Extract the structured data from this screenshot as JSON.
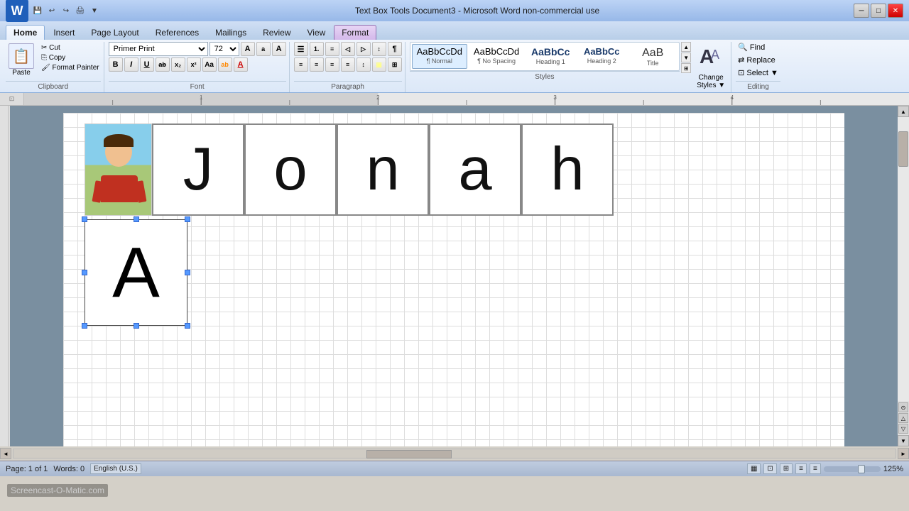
{
  "titlebar": {
    "title": "Text Box Tools    Document3 - Microsoft Word non-commercial use",
    "minimize": "─",
    "maximize": "□",
    "close": "✕"
  },
  "tabs": {
    "items": [
      "Home",
      "Insert",
      "Page Layout",
      "References",
      "Mailings",
      "Review",
      "View",
      "Format"
    ],
    "active": "Home",
    "format_tab": "Format"
  },
  "ribbon": {
    "clipboard": {
      "label": "Clipboard",
      "paste": "Paste",
      "cut": "✂ Cut",
      "copy": "⎘ Copy",
      "format_painter": "🖌 Format Painter"
    },
    "font": {
      "label": "Font",
      "font_name": "Primer Print",
      "font_size": "72",
      "grow": "A",
      "shrink": "a",
      "clear": "A",
      "bold": "B",
      "italic": "I",
      "underline": "U",
      "strikethrough": "ab",
      "subscript": "x₂",
      "superscript": "x²",
      "change_case": "Aa",
      "highlight": "ab",
      "font_color": "A"
    },
    "paragraph": {
      "label": "Paragraph",
      "bullets": "☰",
      "numbering": "1.",
      "outdent": "◁",
      "indent": "▷",
      "sort": "↕",
      "show_hide": "¶"
    },
    "styles": {
      "label": "Styles",
      "items": [
        {
          "id": "normal",
          "preview": "AaBbCcDd",
          "label": "¶ Normal",
          "active": true
        },
        {
          "id": "no-spacing",
          "preview": "AaBbCcDd",
          "label": "¶ No Spacing",
          "active": false
        },
        {
          "id": "heading1",
          "preview": "AaBbCc",
          "label": "Heading 1",
          "active": false
        },
        {
          "id": "heading2",
          "preview": "AaBbCc",
          "label": "Heading 2",
          "active": false
        },
        {
          "id": "title",
          "preview": "AaB",
          "label": "Title",
          "active": false
        }
      ]
    },
    "change_styles": {
      "label": "Change\nStyles",
      "icon": "A"
    },
    "editing": {
      "label": "Editing",
      "find": "Find",
      "replace": "Replace",
      "select": "Select"
    }
  },
  "document": {
    "letters": [
      "J",
      "o",
      "n",
      "a",
      "h"
    ],
    "selected_letter": "A",
    "zoom": "125%"
  },
  "statusbar": {
    "page_info": "Page: 1 of 1",
    "words": "Words: 0",
    "language": "English (U.S.)",
    "zoom_level": "125%"
  },
  "watermark": "Screencast-O-Matic.com"
}
